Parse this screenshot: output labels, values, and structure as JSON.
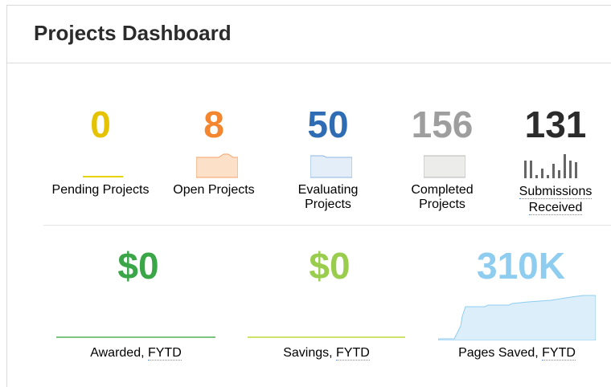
{
  "header": {
    "title": "Projects Dashboard"
  },
  "top_metrics": [
    {
      "value": "0",
      "label": "Pending Projects",
      "color": "#e6c300"
    },
    {
      "value": "8",
      "label": "Open Projects",
      "color": "#f4862f"
    },
    {
      "value": "50",
      "label": "Evaluating Projects",
      "color": "#2e6db4"
    },
    {
      "value": "156",
      "label": "Completed Projects",
      "color": "#9e9e9e"
    },
    {
      "value": "131",
      "label_line1": "Submissions",
      "label_line2": "Received",
      "color": "#2b2b2b"
    }
  ],
  "bottom_metrics": [
    {
      "value": "$0",
      "label_text": "Awarded, ",
      "label_link": "FYTD",
      "color": "#3aa648"
    },
    {
      "value": "$0",
      "label_text": "Savings, ",
      "label_link": "FYTD",
      "color": "#9acd4e"
    },
    {
      "value": "310K",
      "label_text": "Pages Saved, ",
      "label_link": "FYTD",
      "color": "#8ecdf0"
    }
  ]
}
